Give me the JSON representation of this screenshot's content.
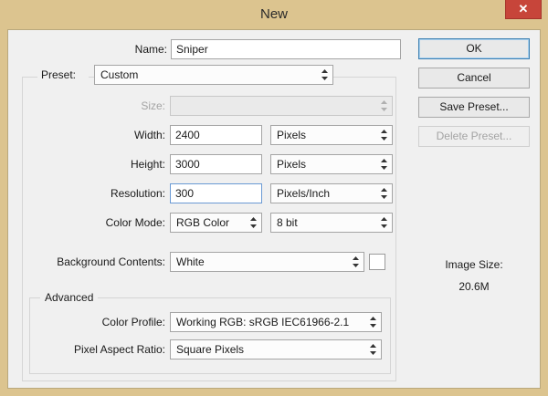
{
  "window": {
    "title": "New",
    "close_glyph": "✕"
  },
  "name_field": {
    "label": "Name:",
    "value": "Sniper"
  },
  "preset": {
    "label": "Preset:",
    "value": "Custom"
  },
  "size": {
    "label": "Size:",
    "value": ""
  },
  "width": {
    "label": "Width:",
    "value": "2400",
    "unit": "Pixels"
  },
  "height": {
    "label": "Height:",
    "value": "3000",
    "unit": "Pixels"
  },
  "resolution": {
    "label": "Resolution:",
    "value": "300",
    "unit": "Pixels/Inch"
  },
  "color_mode": {
    "label": "Color Mode:",
    "value": "RGB Color",
    "depth": "8 bit"
  },
  "background": {
    "label": "Background Contents:",
    "value": "White",
    "swatch_color": "#ffffff"
  },
  "advanced": {
    "legend": "Advanced",
    "color_profile": {
      "label": "Color Profile:",
      "value": "Working RGB:  sRGB IEC61966-2.1"
    },
    "pixel_aspect": {
      "label": "Pixel Aspect Ratio:",
      "value": "Square Pixels"
    }
  },
  "buttons": {
    "ok": "OK",
    "cancel": "Cancel",
    "save_preset": "Save Preset...",
    "delete_preset": "Delete Preset..."
  },
  "image_size": {
    "label": "Image Size:",
    "value": "20.6M"
  },
  "icons": {
    "dropdown": "updown-arrows-icon",
    "close": "close-icon"
  }
}
